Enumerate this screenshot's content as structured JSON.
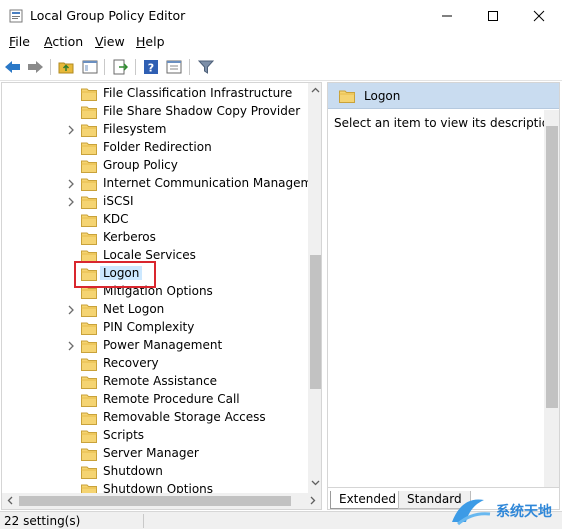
{
  "window": {
    "title": "Local Group Policy Editor"
  },
  "menu": {
    "items": [
      {
        "label": "File",
        "accel": "F"
      },
      {
        "label": "Action",
        "accel": "A"
      },
      {
        "label": "View",
        "accel": "V"
      },
      {
        "label": "Help",
        "accel": "H"
      }
    ]
  },
  "toolbar": {
    "buttons": [
      "back-arrow-icon",
      "forward-arrow-icon",
      "up-folder-icon",
      "show-hide-tree-icon",
      "export-list-icon",
      "help-icon",
      "properties-icon",
      "filter-icon"
    ]
  },
  "tree": {
    "items": [
      {
        "label": "File Classification Infrastructure",
        "expandable": false
      },
      {
        "label": "File Share Shadow Copy Provider",
        "expandable": false
      },
      {
        "label": "Filesystem",
        "expandable": true
      },
      {
        "label": "Folder Redirection",
        "expandable": false
      },
      {
        "label": "Group Policy",
        "expandable": false
      },
      {
        "label": "Internet Communication Management",
        "expandable": true
      },
      {
        "label": "iSCSI",
        "expandable": true
      },
      {
        "label": "KDC",
        "expandable": false
      },
      {
        "label": "Kerberos",
        "expandable": false
      },
      {
        "label": "Locale Services",
        "expandable": false
      },
      {
        "label": "Logon",
        "expandable": false,
        "selected": true
      },
      {
        "label": "Mitigation Options",
        "expandable": false
      },
      {
        "label": "Net Logon",
        "expandable": true
      },
      {
        "label": "PIN Complexity",
        "expandable": false
      },
      {
        "label": "Power Management",
        "expandable": true
      },
      {
        "label": "Recovery",
        "expandable": false
      },
      {
        "label": "Remote Assistance",
        "expandable": false
      },
      {
        "label": "Remote Procedure Call",
        "expandable": false
      },
      {
        "label": "Removable Storage Access",
        "expandable": false
      },
      {
        "label": "Scripts",
        "expandable": false
      },
      {
        "label": "Server Manager",
        "expandable": false
      },
      {
        "label": "Shutdown",
        "expandable": false
      },
      {
        "label": "Shutdown Options",
        "expandable": false
      }
    ]
  },
  "details": {
    "header": "Logon",
    "description": "Select an item to view its description."
  },
  "tabs": [
    {
      "label": "Extended"
    },
    {
      "label": "Standard"
    }
  ],
  "status": {
    "text": "22 setting(s)"
  },
  "watermark": {
    "text": "系统天地"
  },
  "colors": {
    "selection": "#cce8ff",
    "header": "#c9dcf0",
    "highlight_box": "#d9262e",
    "folder": "#f2c94c"
  }
}
